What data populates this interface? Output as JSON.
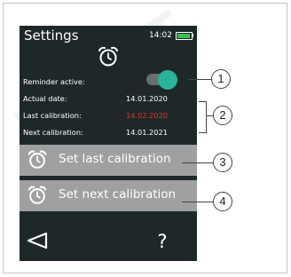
{
  "screen": {
    "title": "Settings",
    "time": "14:02",
    "battery_color": "#37c24a",
    "header_icon": "alarm-clock-icon"
  },
  "settings": {
    "reminder_label": "Reminder active:",
    "reminder_on": true,
    "actual_date_label": "Actual date:",
    "actual_date_value": "14.01.2020",
    "last_calibration_label": "Last calibration:",
    "last_calibration_value": "14.02.2020",
    "next_calibration_label": "Next calibration:",
    "next_calibration_value": "14.01.2021"
  },
  "buttons": {
    "set_last_label": "Set last calibration",
    "set_next_label": "Set next calibration",
    "back_icon": "back-arrow-icon",
    "help_label": "?"
  },
  "callouts": [
    "1",
    "2",
    "3",
    "4"
  ],
  "colors": {
    "screen_bg": "#1f2829",
    "button_bg": "#9ea0a1",
    "accent_teal": "#26b49a",
    "warning_red": "#e0302f"
  }
}
